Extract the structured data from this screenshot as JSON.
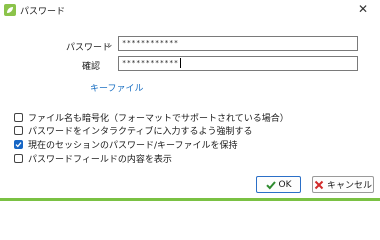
{
  "window": {
    "title": "パスワード",
    "close_glyph": "✕",
    "accent": "#7ac143"
  },
  "form": {
    "password_label": "パスワード",
    "password_value": "************",
    "confirm_label": "確認",
    "confirm_value": "************",
    "keyfile_link": "キーファイル",
    "link_color": "#1a6fc2"
  },
  "options": [
    {
      "label": "ファイル名も暗号化（フォーマットでサポートされている場合）",
      "checked": false
    },
    {
      "label": "パスワードをインタラクティブに入力するよう強制する",
      "checked": false
    },
    {
      "label": "現在のセッションのパスワード/キーファイルを保持",
      "checked": true
    },
    {
      "label": "パスワードフィールドの内容を表示",
      "checked": false
    }
  ],
  "buttons": {
    "ok": "OK",
    "cancel": "キャンセル"
  },
  "icons": {
    "app": "leaf-icon",
    "password_dropdown": "chevron-down-icon",
    "ok": "check-icon",
    "cancel": "x-icon"
  }
}
